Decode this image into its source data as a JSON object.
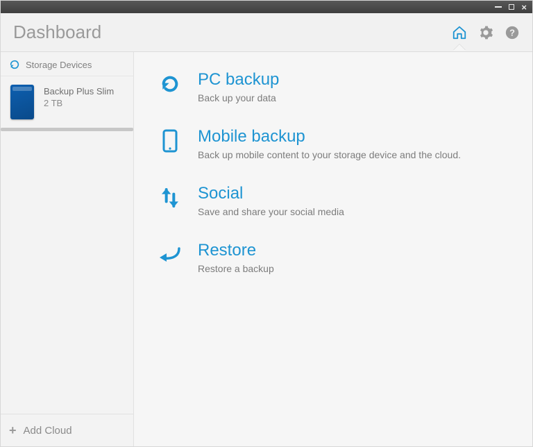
{
  "titlebar": {
    "minimize": "–",
    "maximize": "□",
    "close": "×"
  },
  "header": {
    "title": "Dashboard"
  },
  "sidebar": {
    "section_label": "Storage Devices",
    "device": {
      "name": "Backup Plus Slim",
      "capacity": "2 TB"
    },
    "add_cloud_label": "Add Cloud"
  },
  "main": {
    "items": [
      {
        "title": "PC backup",
        "desc": "Back up your data"
      },
      {
        "title": "Mobile backup",
        "desc": "Back up mobile content to your storage device and the cloud."
      },
      {
        "title": "Social",
        "desc": "Save and share your social media"
      },
      {
        "title": "Restore",
        "desc": "Restore a backup"
      }
    ]
  },
  "colors": {
    "accent": "#1e94d2"
  }
}
